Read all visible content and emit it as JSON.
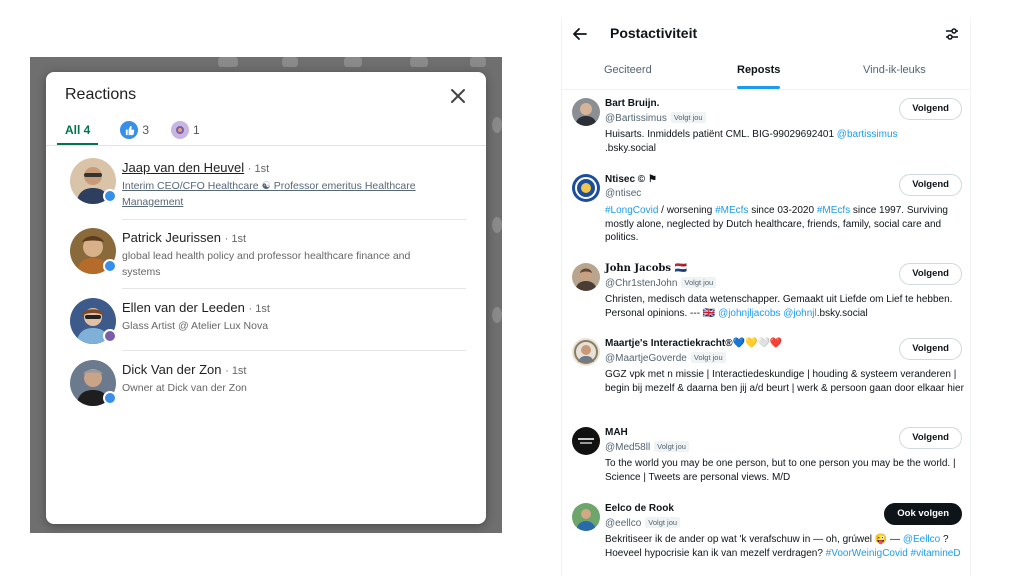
{
  "linkedin": {
    "modal_title": "Reactions",
    "tabs": [
      {
        "label": "All 4",
        "icon": "none"
      },
      {
        "label": "3",
        "icon": "like-icon",
        "color": "#378fe9"
      },
      {
        "label": "1",
        "icon": "celebrate-icon",
        "color": "#7a5fa8"
      }
    ],
    "accent": "#01754f",
    "people": [
      {
        "name": "Jaap van den Heuvel",
        "degree": "· 1st",
        "subtitle": "Interim CEO/CFO Healthcare ☯ Professor emeritus Healthcare Management"
      },
      {
        "name": "Patrick Jeurissen",
        "degree": "· 1st",
        "subtitle": "global lead health policy and professor healthcare finance and systems"
      },
      {
        "name": "Ellen van der Leeden",
        "degree": "· 1st",
        "subtitle": "Glass Artist @ Atelier Lux Nova"
      },
      {
        "name": "Dick Van der Zon",
        "degree": "· 1st",
        "subtitle": "Owner at Dick van der Zon"
      }
    ]
  },
  "x": {
    "title": "Postactiviteit",
    "tabs": [
      "Geciteerd",
      "Reposts",
      "Vind-ik-leuks"
    ],
    "active_tab": "Reposts",
    "accent": "#1d9bf0",
    "follows_you": "Volgt jou",
    "users": [
      {
        "name": "Bart Bruijn.",
        "handle": "@Bartissimus",
        "follows_you": true,
        "button": "Volgend",
        "bio_a": "Huisarts. Inmiddels patiënt CML. BIG-99029692401 ",
        "bio_link": "@bartissimus",
        "bio_b": " .bsky.social"
      },
      {
        "name": "Ntisec © ⚑",
        "handle": "@ntisec",
        "follows_you": false,
        "button": "Volgend",
        "bio_link": "#LongCovid",
        "bio_a": " / worsening ",
        "bio_link2": "#MEcfs",
        "bio_b": " since 03-2020 ",
        "bio_link3": "#MEcfs",
        "bio_c": " since 1997. Surviving mostly alone, neglected by Dutch healthcare, friends, family, social care and politics."
      },
      {
        "name": "John Jacobs 🇳🇱",
        "handle": "@Chr1stenJohn",
        "follows_you": true,
        "button": "Volgend",
        "bio_a": "Christen, medisch data wetenschapper. Gemaakt uit Liefde om Lief te hebben. Personal opinions. --- 🇬🇧 ",
        "bio_link": "@johnjljacobs @johnjl",
        "bio_b": ".bsky.social"
      },
      {
        "name": "Maartje's Interactiekracht®💙💛🤍❤️",
        "handle": "@MaartjeGoverde",
        "follows_you": true,
        "button": "Volgend",
        "bio_a": "GGZ vpk met n missie | Interactiedeskundige | houding & systeem veranderen | begin bij mezelf & daarna ben jij a/d beurt | werk & persoon gaan door elkaar hier"
      },
      {
        "name": "MAH",
        "handle": "@Med58ll",
        "follows_you": true,
        "button": "Volgend",
        "bio_a": "To the world you may be one person, but to one person you may be the world. | Science | Tweets are personal views. M/D"
      },
      {
        "name": "Eelco de Rook",
        "handle": "@eellco",
        "follows_you": true,
        "button": "Ook volgen",
        "bio_a": "Bekritiseer ik de ander op wat 'k verafschuw in — oh, grúwel 😜 — ",
        "bio_link": "@Eellco",
        "bio_b": " ? Hoeveel hypocrisie kan ik van mezelf verdragen? ",
        "bio_link2": "#VoorWeinigCovid #vitamineD"
      }
    ]
  }
}
